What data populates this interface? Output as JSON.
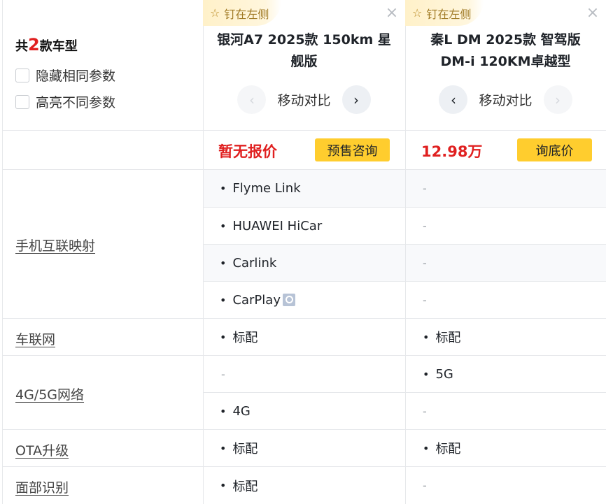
{
  "summary": {
    "prefix": "共",
    "count": "2",
    "suffix": "款车型"
  },
  "options": [
    {
      "label": "隐藏相同参数"
    },
    {
      "label": "高亮不同参数"
    }
  ],
  "cars": [
    {
      "pin_label": "钉在左侧",
      "name": "银河A7 2025款 150km 星舰版",
      "move_label": "移动对比",
      "price": "暂无报价",
      "price_button": "预售咨询"
    },
    {
      "pin_label": "钉在左侧",
      "name": "秦L DM 2025款 智驾版 DM-i 120KM卓越型",
      "move_label": "移动对比",
      "price": "12.98万",
      "price_button": "询底价"
    }
  ],
  "icons": {
    "pin": "pin-icon",
    "close": "close-icon",
    "prev": "chevron-left-icon",
    "next": "chevron-right-icon",
    "magnifier": "search-icon"
  },
  "rows": [
    {
      "group": "手机互联映射",
      "car1": "Flyme Link",
      "car2": "-"
    },
    {
      "group": "手机互联映射",
      "car1": "HUAWEI HiCar",
      "car2": "-"
    },
    {
      "group": "手机互联映射",
      "car1": "Carlink",
      "car2": "-"
    },
    {
      "group": "手机互联映射",
      "car1": "CarPlay",
      "car2": "-"
    },
    {
      "group": "车联网",
      "car1": "标配",
      "car2": "标配"
    },
    {
      "group": "4G/5G网络",
      "car1": "-",
      "car2": "5G"
    },
    {
      "group": "4G/5G网络",
      "car1": "4G",
      "car2": "-"
    },
    {
      "group": "OTA升级",
      "car1": "标配",
      "car2": "标配"
    },
    {
      "group": "面部识别",
      "car1": "标配",
      "car2": "-"
    }
  ],
  "groups": [
    "手机互联映射",
    "车联网",
    "4G/5G网络",
    "OTA升级",
    "面部识别"
  ]
}
